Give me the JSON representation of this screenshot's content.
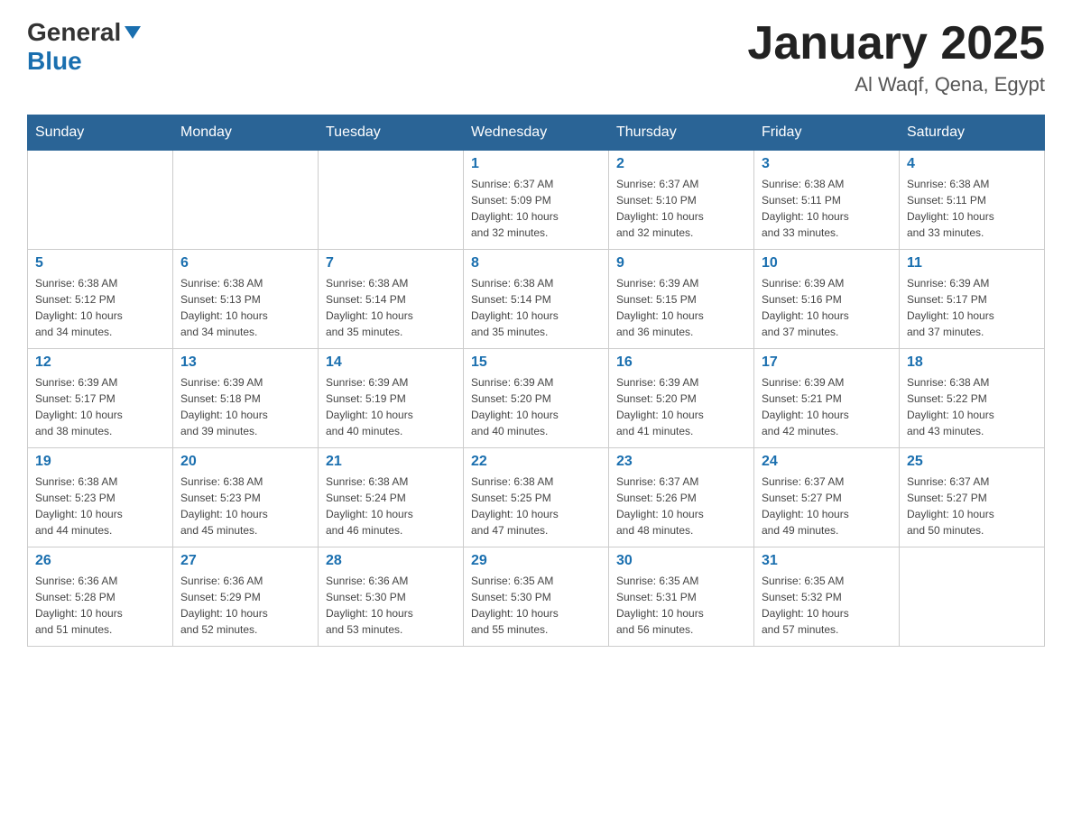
{
  "header": {
    "logo_general": "General",
    "logo_blue": "Blue",
    "month_title": "January 2025",
    "location": "Al Waqf, Qena, Egypt"
  },
  "weekdays": [
    "Sunday",
    "Monday",
    "Tuesday",
    "Wednesday",
    "Thursday",
    "Friday",
    "Saturday"
  ],
  "weeks": [
    [
      {
        "day": "",
        "info": ""
      },
      {
        "day": "",
        "info": ""
      },
      {
        "day": "",
        "info": ""
      },
      {
        "day": "1",
        "info": "Sunrise: 6:37 AM\nSunset: 5:09 PM\nDaylight: 10 hours\nand 32 minutes."
      },
      {
        "day": "2",
        "info": "Sunrise: 6:37 AM\nSunset: 5:10 PM\nDaylight: 10 hours\nand 32 minutes."
      },
      {
        "day": "3",
        "info": "Sunrise: 6:38 AM\nSunset: 5:11 PM\nDaylight: 10 hours\nand 33 minutes."
      },
      {
        "day": "4",
        "info": "Sunrise: 6:38 AM\nSunset: 5:11 PM\nDaylight: 10 hours\nand 33 minutes."
      }
    ],
    [
      {
        "day": "5",
        "info": "Sunrise: 6:38 AM\nSunset: 5:12 PM\nDaylight: 10 hours\nand 34 minutes."
      },
      {
        "day": "6",
        "info": "Sunrise: 6:38 AM\nSunset: 5:13 PM\nDaylight: 10 hours\nand 34 minutes."
      },
      {
        "day": "7",
        "info": "Sunrise: 6:38 AM\nSunset: 5:14 PM\nDaylight: 10 hours\nand 35 minutes."
      },
      {
        "day": "8",
        "info": "Sunrise: 6:38 AM\nSunset: 5:14 PM\nDaylight: 10 hours\nand 35 minutes."
      },
      {
        "day": "9",
        "info": "Sunrise: 6:39 AM\nSunset: 5:15 PM\nDaylight: 10 hours\nand 36 minutes."
      },
      {
        "day": "10",
        "info": "Sunrise: 6:39 AM\nSunset: 5:16 PM\nDaylight: 10 hours\nand 37 minutes."
      },
      {
        "day": "11",
        "info": "Sunrise: 6:39 AM\nSunset: 5:17 PM\nDaylight: 10 hours\nand 37 minutes."
      }
    ],
    [
      {
        "day": "12",
        "info": "Sunrise: 6:39 AM\nSunset: 5:17 PM\nDaylight: 10 hours\nand 38 minutes."
      },
      {
        "day": "13",
        "info": "Sunrise: 6:39 AM\nSunset: 5:18 PM\nDaylight: 10 hours\nand 39 minutes."
      },
      {
        "day": "14",
        "info": "Sunrise: 6:39 AM\nSunset: 5:19 PM\nDaylight: 10 hours\nand 40 minutes."
      },
      {
        "day": "15",
        "info": "Sunrise: 6:39 AM\nSunset: 5:20 PM\nDaylight: 10 hours\nand 40 minutes."
      },
      {
        "day": "16",
        "info": "Sunrise: 6:39 AM\nSunset: 5:20 PM\nDaylight: 10 hours\nand 41 minutes."
      },
      {
        "day": "17",
        "info": "Sunrise: 6:39 AM\nSunset: 5:21 PM\nDaylight: 10 hours\nand 42 minutes."
      },
      {
        "day": "18",
        "info": "Sunrise: 6:38 AM\nSunset: 5:22 PM\nDaylight: 10 hours\nand 43 minutes."
      }
    ],
    [
      {
        "day": "19",
        "info": "Sunrise: 6:38 AM\nSunset: 5:23 PM\nDaylight: 10 hours\nand 44 minutes."
      },
      {
        "day": "20",
        "info": "Sunrise: 6:38 AM\nSunset: 5:23 PM\nDaylight: 10 hours\nand 45 minutes."
      },
      {
        "day": "21",
        "info": "Sunrise: 6:38 AM\nSunset: 5:24 PM\nDaylight: 10 hours\nand 46 minutes."
      },
      {
        "day": "22",
        "info": "Sunrise: 6:38 AM\nSunset: 5:25 PM\nDaylight: 10 hours\nand 47 minutes."
      },
      {
        "day": "23",
        "info": "Sunrise: 6:37 AM\nSunset: 5:26 PM\nDaylight: 10 hours\nand 48 minutes."
      },
      {
        "day": "24",
        "info": "Sunrise: 6:37 AM\nSunset: 5:27 PM\nDaylight: 10 hours\nand 49 minutes."
      },
      {
        "day": "25",
        "info": "Sunrise: 6:37 AM\nSunset: 5:27 PM\nDaylight: 10 hours\nand 50 minutes."
      }
    ],
    [
      {
        "day": "26",
        "info": "Sunrise: 6:36 AM\nSunset: 5:28 PM\nDaylight: 10 hours\nand 51 minutes."
      },
      {
        "day": "27",
        "info": "Sunrise: 6:36 AM\nSunset: 5:29 PM\nDaylight: 10 hours\nand 52 minutes."
      },
      {
        "day": "28",
        "info": "Sunrise: 6:36 AM\nSunset: 5:30 PM\nDaylight: 10 hours\nand 53 minutes."
      },
      {
        "day": "29",
        "info": "Sunrise: 6:35 AM\nSunset: 5:30 PM\nDaylight: 10 hours\nand 55 minutes."
      },
      {
        "day": "30",
        "info": "Sunrise: 6:35 AM\nSunset: 5:31 PM\nDaylight: 10 hours\nand 56 minutes."
      },
      {
        "day": "31",
        "info": "Sunrise: 6:35 AM\nSunset: 5:32 PM\nDaylight: 10 hours\nand 57 minutes."
      },
      {
        "day": "",
        "info": ""
      }
    ]
  ]
}
